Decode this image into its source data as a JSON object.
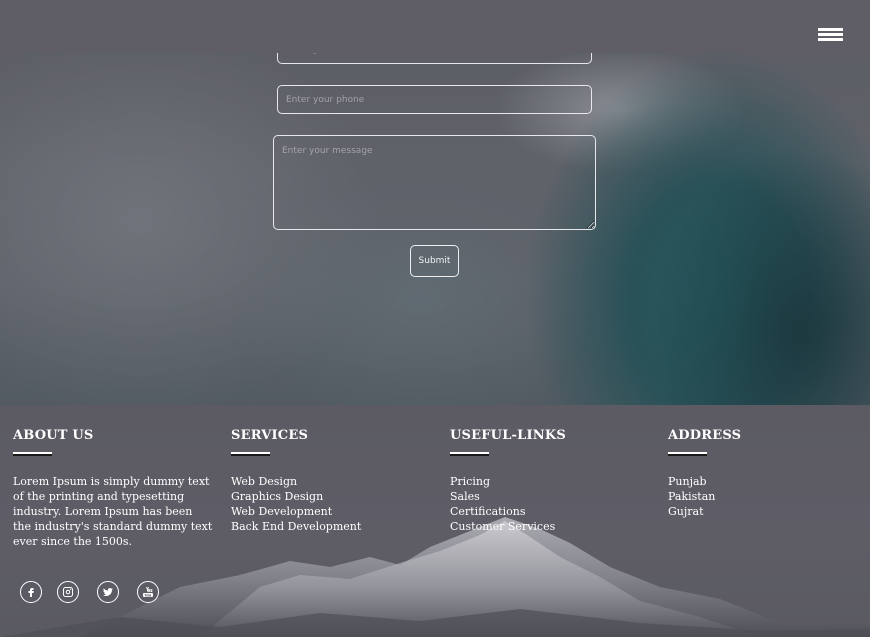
{
  "contact_form": {
    "email_placeholder": "Enter your email",
    "phone_placeholder": "Enter your phone",
    "message_placeholder": "Enter your message",
    "submit_label": "Submit"
  },
  "nav": {
    "menu_icon": "hamburger-menu-icon"
  },
  "footer": {
    "about": {
      "title": "ABOUT US",
      "text": "Lorem Ipsum is simply dummy text of the printing and typesetting industry. Lorem Ipsum has been the industry's standard dummy text ever since the 1500s."
    },
    "services": {
      "title": "SERVICES",
      "items": [
        "Web Design",
        "Graphics Design",
        "Web Development",
        "Back End Development"
      ]
    },
    "useful_links": {
      "title": "USEFUL-LINKS",
      "items": [
        "Pricing",
        "Sales",
        "Certifications",
        "Customer Services"
      ]
    },
    "address": {
      "title": "ADDRESS",
      "items": [
        "Punjab",
        "Pakistan",
        "Gujrat"
      ]
    },
    "social_icons": [
      "facebook-icon",
      "instagram-icon",
      "twitter-icon",
      "youtube-icon"
    ]
  },
  "colors": {
    "nav_bg": "#5f5e66",
    "footer_bg": "#5c5b64",
    "text": "#ffffff"
  }
}
